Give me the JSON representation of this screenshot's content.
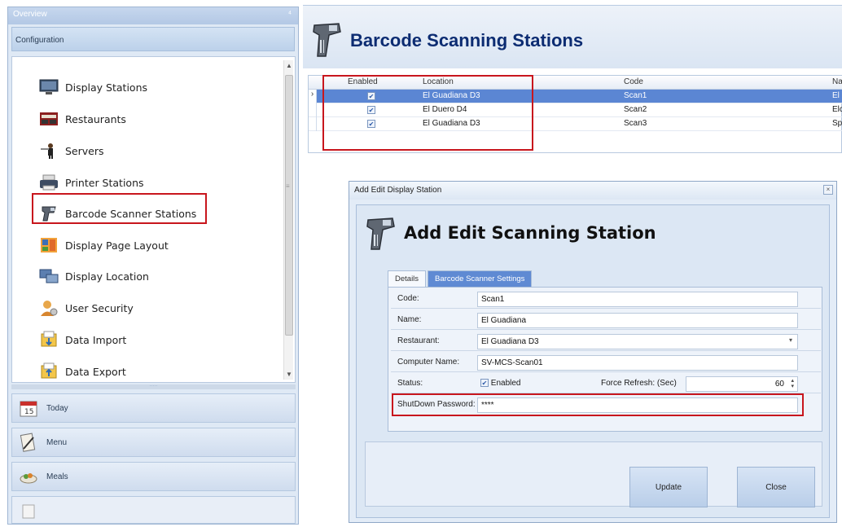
{
  "left_panel": {
    "overview_label": "Overview",
    "config_label": "Configuration",
    "nav_items": [
      {
        "label": "Display Stations",
        "icon": "monitor-icon"
      },
      {
        "label": "Restaurants",
        "icon": "restaurant-icon"
      },
      {
        "label": "Servers",
        "icon": "server-waiter-icon"
      },
      {
        "label": "Printer Stations",
        "icon": "printer-icon"
      },
      {
        "label": "Barcode Scanner Stations",
        "icon": "barcode-scanner-icon"
      },
      {
        "label": "Display Page Layout",
        "icon": "page-layout-icon"
      },
      {
        "label": "Display Location",
        "icon": "location-icon"
      },
      {
        "label": "User Security",
        "icon": "user-security-icon"
      },
      {
        "label": "Data Import",
        "icon": "data-import-icon"
      },
      {
        "label": "Data Export",
        "icon": "data-export-icon"
      }
    ],
    "bottom_nav": [
      {
        "label": "Today",
        "icon": "calendar-icon"
      },
      {
        "label": "Menu",
        "icon": "menu-icon"
      },
      {
        "label": "Meals",
        "icon": "meals-icon"
      }
    ]
  },
  "main": {
    "title": "Barcode Scanning Stations",
    "grid": {
      "headers": [
        "Enabled",
        "Location",
        "Code",
        "Na"
      ],
      "rows": [
        {
          "enabled": "✔",
          "location": "El Guadiana D3",
          "code": "Scan1",
          "name": "El"
        },
        {
          "enabled": "✔",
          "location": "El Duero D4",
          "code": "Scan2",
          "name": "Elc"
        },
        {
          "enabled": "✔",
          "location": "El Guadiana D3",
          "code": "Scan3",
          "name": "Sp"
        }
      ]
    }
  },
  "dialog": {
    "window_title": "Add Edit Display Station",
    "close_glyph": "×",
    "heading": "Add Edit Scanning Station",
    "tabs": [
      "Details",
      "Barcode Scanner Settings"
    ],
    "fields": {
      "code_label": "Code:",
      "code_value": "Scan1",
      "name_label": "Name:",
      "name_value": "El Guadiana",
      "restaurant_label": "Restaurant:",
      "restaurant_value": "El Guadiana D3",
      "computer_label": "Computer Name:",
      "computer_value": "SV-MCS-Scan01",
      "status_label": "Status:",
      "status_check_label": "Enabled",
      "refresh_label": "Force Refresh: (Sec)",
      "refresh_value": "60",
      "password_label": "ShutDown Password:",
      "password_value": "****"
    },
    "buttons": {
      "update": "Update",
      "close": "Close"
    }
  },
  "colors": {
    "title_blue": "#0c2c72",
    "selected_row": "#5b86d3",
    "highlight_red": "#c8161d"
  }
}
